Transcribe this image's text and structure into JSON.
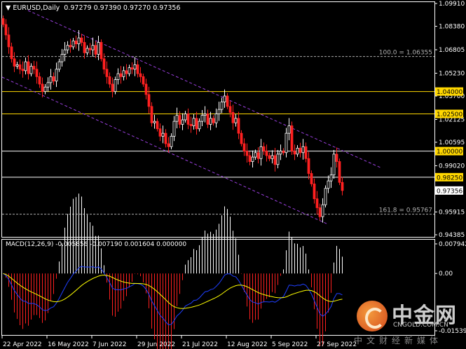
{
  "header": {
    "symbol": "EURUSD,Daily",
    "ohlc": "0.97279 0.97390 0.97270 0.97356"
  },
  "macd_header": "MACD(12,26,9) -0.005856 -0.007190 0.001604 0.000000",
  "chart_data": {
    "type": "candlestick",
    "symbol": "EURUSD",
    "timeframe": "Daily",
    "ylim": [
      0.94385,
      1.0991
    ],
    "y_ticks": [
      "1.09910",
      "1.08380",
      "1.06805",
      "1.05230",
      "1.03700",
      "1.02125",
      "1.00595",
      "0.99020",
      "0.95915",
      "0.94385"
    ],
    "x_ticks": [
      "22 Apr 2022",
      "16 May 2022",
      "7 Jun 2022",
      "29 Jun 2022",
      "21 Jul 2022",
      "12 Aug 2022",
      "5 Sep 2022",
      "27 Sep 2022"
    ],
    "closes": [
      1.085,
      1.078,
      1.07,
      1.062,
      1.057,
      1.058,
      1.055,
      1.054,
      1.06,
      1.052,
      1.057,
      1.055,
      1.05,
      1.045,
      1.04,
      1.043,
      1.046,
      1.05,
      1.047,
      1.055,
      1.06,
      1.065,
      1.068,
      1.071,
      1.07,
      1.074,
      1.072,
      1.076,
      1.073,
      1.066,
      1.069,
      1.068,
      1.071,
      1.065,
      1.073,
      1.062,
      1.055,
      1.05,
      1.045,
      1.04,
      1.048,
      1.052,
      1.05,
      1.054,
      1.052,
      1.056,
      1.055,
      1.058,
      1.052,
      1.05,
      1.045,
      1.038,
      1.03,
      1.019,
      1.02,
      1.015,
      1.01,
      1.012,
      1.005,
      1.003,
      1.01,
      1.02,
      1.024,
      1.018,
      1.021,
      1.025,
      1.018,
      1.017,
      1.022,
      1.015,
      1.02,
      1.024,
      1.025,
      1.018,
      1.022,
      1.019,
      1.025,
      1.028,
      1.033,
      1.037,
      1.03,
      1.026,
      1.019,
      1.022,
      1.012,
      1.005,
      1.0,
      0.997,
      0.993,
      0.996,
      0.999,
      0.995,
      1.003,
      1.0,
      0.997,
      0.995,
      0.997,
      0.991,
      0.998,
      1.0,
      0.999,
      1.012,
      1.017,
      1.0,
      0.998,
      1.002,
      0.999,
      1.003,
      0.995,
      0.985,
      0.978,
      0.968,
      0.962,
      0.956,
      0.964,
      0.975,
      0.98,
      0.984,
      0.998,
      0.993,
      0.979,
      0.97356
    ],
    "last_price": "0.97356",
    "levels": [
      {
        "label": "1.04000",
        "value": 1.04,
        "color": "#ffd700"
      },
      {
        "label": "1.02500",
        "value": 1.025,
        "color": "#ffd700"
      },
      {
        "label": "1.00000",
        "value": 1.0,
        "color": "#ffffff"
      },
      {
        "label": "0.98250",
        "value": 0.9825,
        "color": "#ffffff"
      }
    ],
    "fibo": [
      {
        "label": "100.0 = 1.06355",
        "value": 1.06355
      },
      {
        "label": "161.8 = 0.95767",
        "value": 0.95767
      }
    ],
    "colors": {
      "bull": "#ffffff",
      "bear": "#ff2020",
      "channel": "#9b40e0",
      "macd": "#1f3fff",
      "signal": "#ffff00"
    },
    "macd": {
      "params": [
        12,
        26,
        9
      ],
      "y_ticks": [
        "0.007942",
        "0.00",
        "-0.015396"
      ]
    }
  },
  "watermark": {
    "brand": "中金网",
    "url": "CNGOLD.COM.CN",
    "tagline": "中文财经新媒体"
  }
}
